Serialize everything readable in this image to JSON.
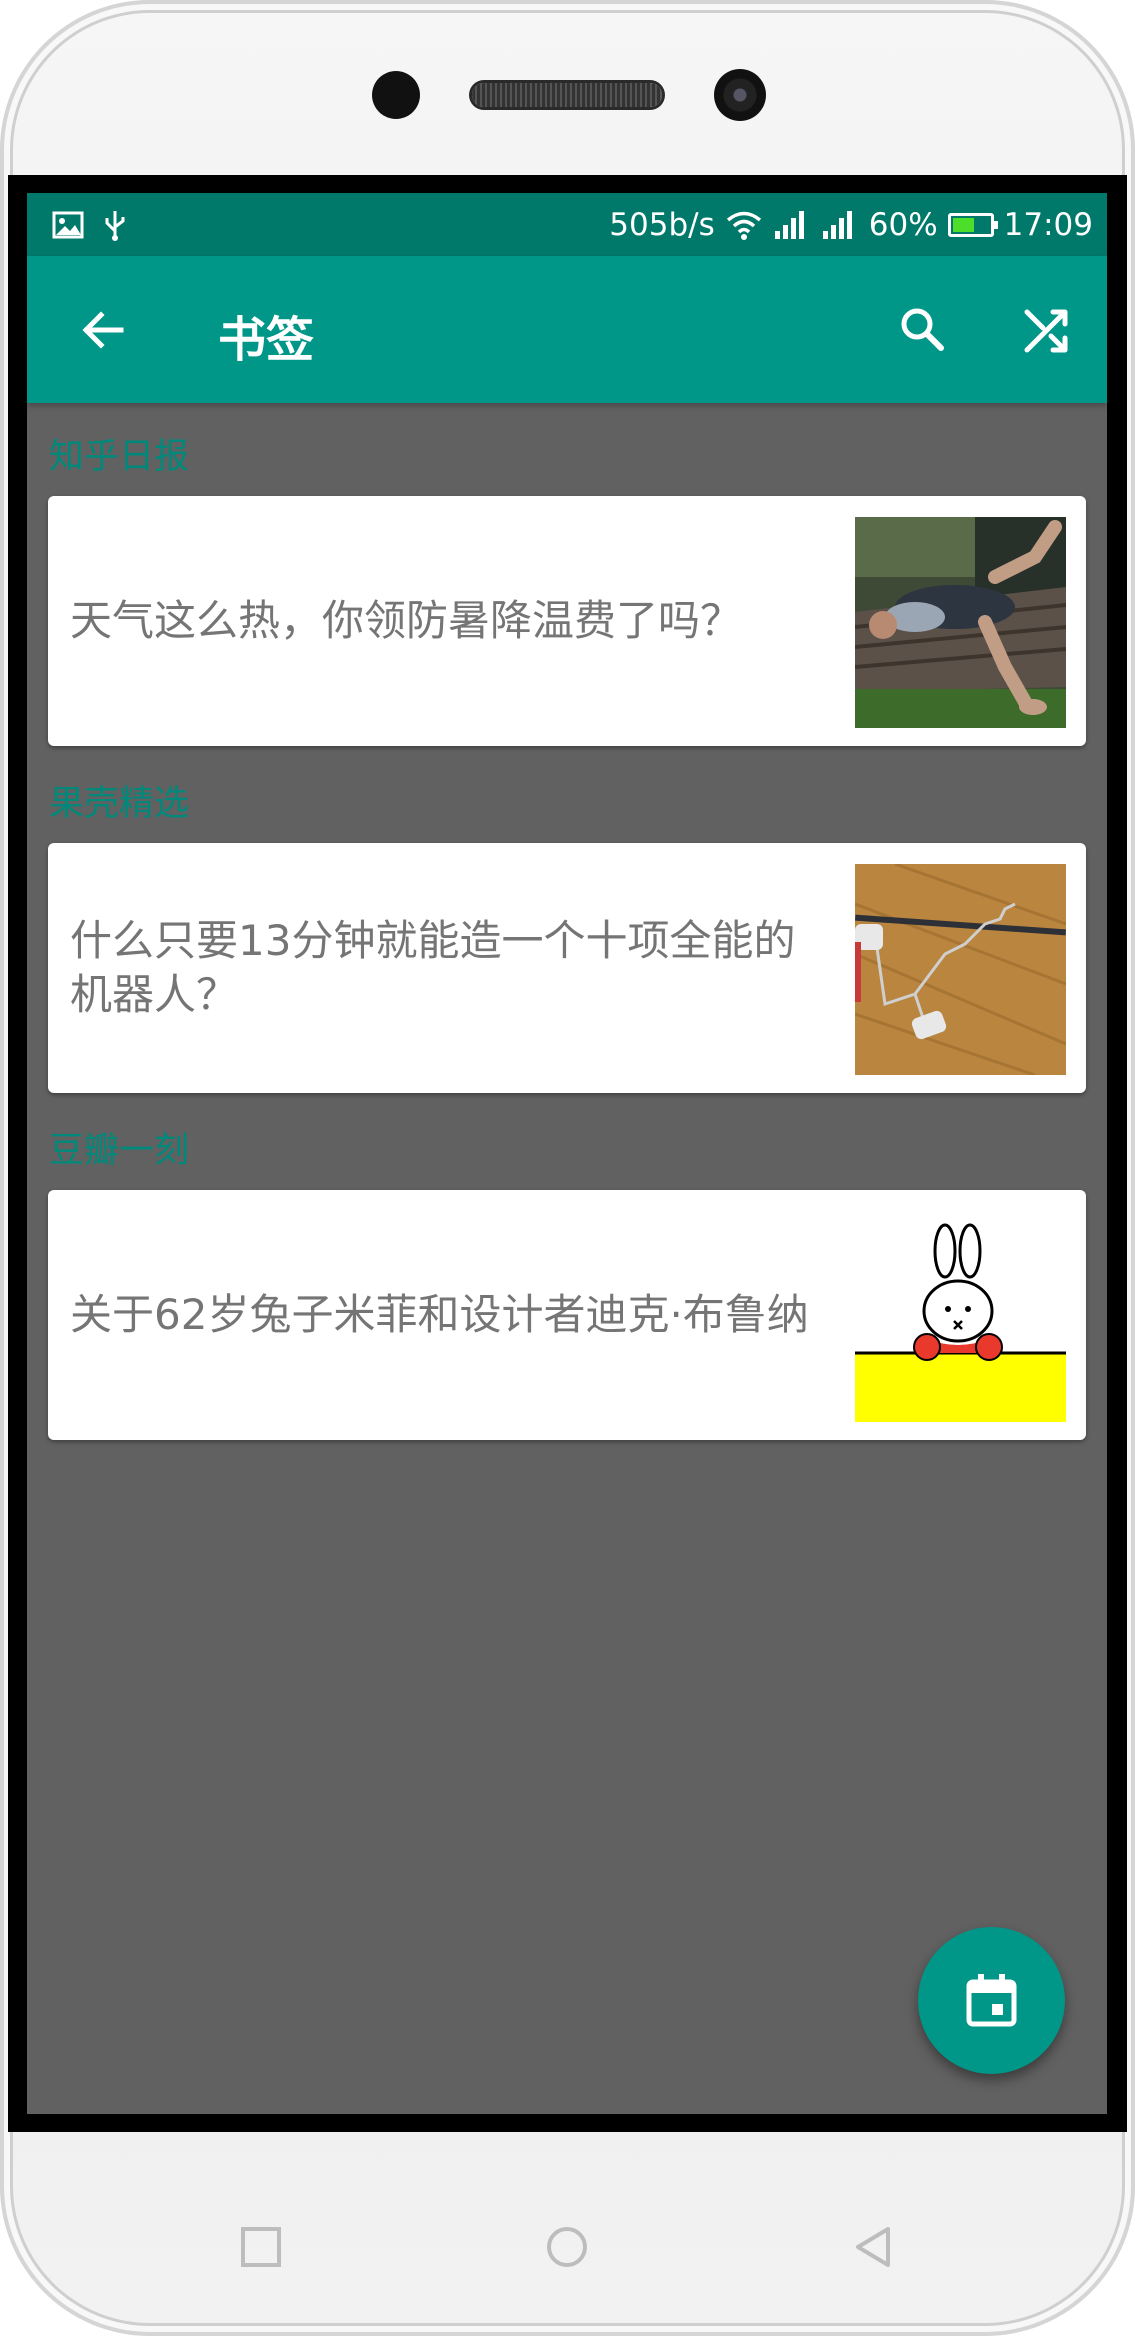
{
  "status_bar": {
    "network_speed": "505b/s",
    "battery": "60%",
    "battery_level": 0.6,
    "time": "17:09",
    "icons": [
      "image-icon",
      "usb-icon",
      "wifi-icon",
      "signal-icon",
      "signal-icon",
      "battery-icon"
    ]
  },
  "app_bar": {
    "title": "书签",
    "back_icon": "arrow-back-icon",
    "search_icon": "search-icon",
    "shuffle_icon": "shuffle-icon"
  },
  "sections": [
    {
      "header": "知乎日报",
      "card": {
        "title": "天气这么热，你领防暑降温费了吗？",
        "thumbnail": "person-lying-on-deck"
      }
    },
    {
      "header": "果壳精选",
      "card": {
        "title": "什么只要13分钟就能造一个十项全能的机器人？",
        "thumbnail": "wire-robot-on-wood-floor"
      }
    },
    {
      "header": "豆瓣一刻",
      "card": {
        "title": "关于62岁兔子米菲和设计者迪克·布鲁纳",
        "thumbnail": "miffy-rabbit"
      }
    }
  ],
  "fab": {
    "icon": "calendar-icon"
  },
  "colors": {
    "primary": "#009688",
    "primary_dark": "#00796b",
    "background": "#616161",
    "section_header": "#00897b",
    "card_text": "#757575"
  }
}
